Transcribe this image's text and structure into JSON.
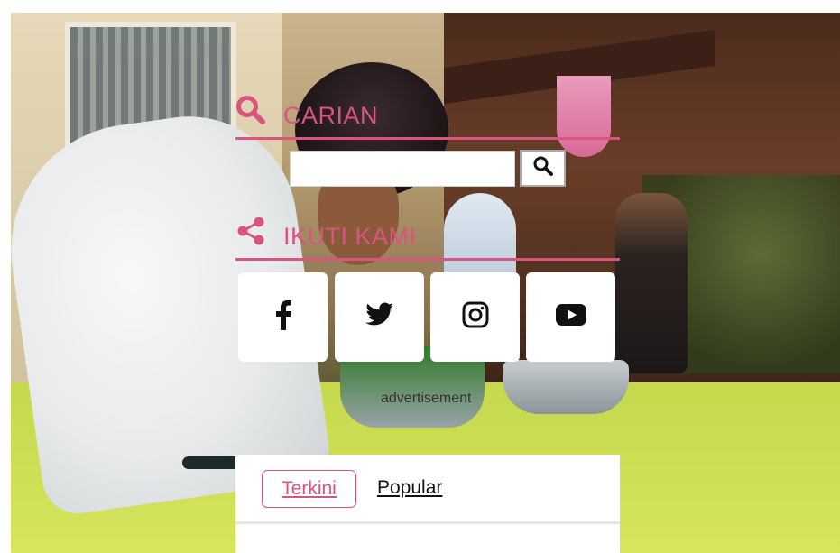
{
  "colors": {
    "accent": "#d9547f",
    "panel": "#ffffff"
  },
  "search_section": {
    "title": "CARIAN",
    "icon": "search-icon",
    "input_value": "",
    "button_icon": "search-icon"
  },
  "follow_section": {
    "title": "IKUTI KAMI",
    "icon": "share-icon",
    "links": [
      {
        "name": "facebook",
        "icon": "facebook-icon"
      },
      {
        "name": "twitter",
        "icon": "twitter-icon"
      },
      {
        "name": "instagram",
        "icon": "instagram-icon"
      },
      {
        "name": "youtube",
        "icon": "youtube-icon"
      }
    ]
  },
  "advertisement": {
    "label": "advertisement"
  },
  "tabs": {
    "items": [
      {
        "label": "Terkini",
        "active": true
      },
      {
        "label": "Popular",
        "active": false
      }
    ]
  }
}
